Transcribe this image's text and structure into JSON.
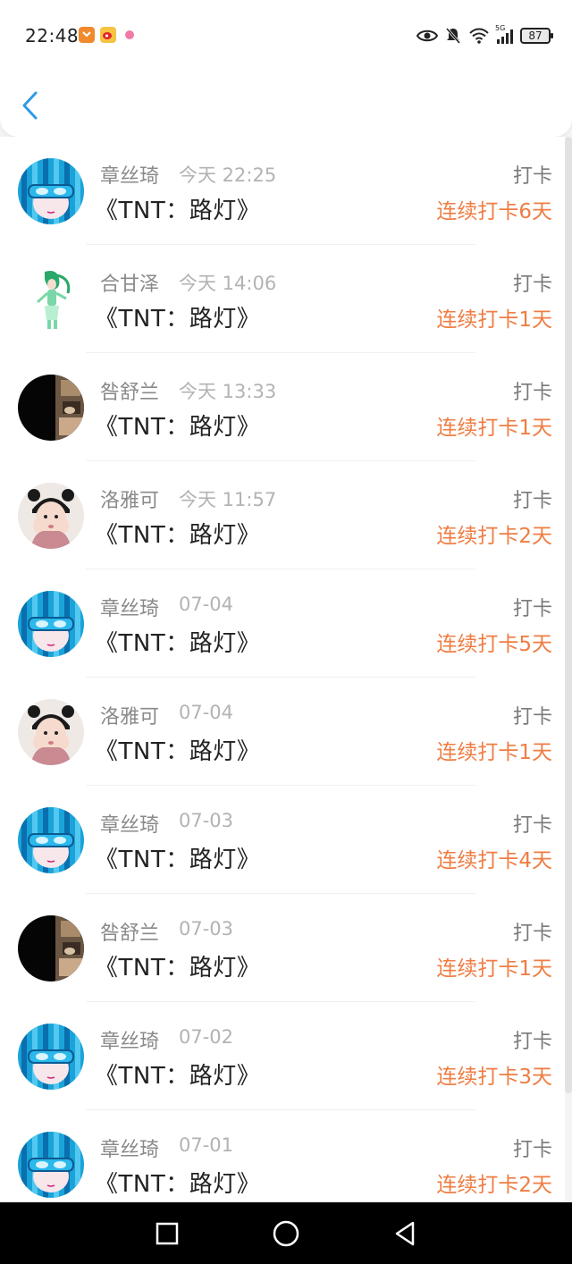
{
  "status_bar": {
    "time": "22:48",
    "battery": "87",
    "network": "5G"
  },
  "header": {
    "back_icon": "chevron-left-icon",
    "accent_color": "#2f9ae8"
  },
  "colors": {
    "streak": "#ef7d43",
    "name": "#8a8a8a",
    "time": "#b3b3b3"
  },
  "items": [
    {
      "name": "章丝琦",
      "time": "今天 22:25",
      "book": "《TNT：路灯》",
      "type": "打卡",
      "streak": "连续打卡6天",
      "avatar": "anime-blue-hair"
    },
    {
      "name": "合甘泽",
      "time": "今天 14:06",
      "book": "《TNT：路灯》",
      "type": "打卡",
      "streak": "连续打卡1天",
      "avatar": "green-figure"
    },
    {
      "name": "咎舒兰",
      "time": "今天 13:33",
      "book": "《TNT：路灯》",
      "type": "打卡",
      "streak": "连续打卡1天",
      "avatar": "dark-portrait"
    },
    {
      "name": "洛雅可",
      "time": "今天 11:57",
      "book": "《TNT：路灯》",
      "type": "打卡",
      "streak": "连续打卡2天",
      "avatar": "girl-photo"
    },
    {
      "name": "章丝琦",
      "time": "07-04",
      "book": "《TNT：路灯》",
      "type": "打卡",
      "streak": "连续打卡5天",
      "avatar": "anime-blue-hair"
    },
    {
      "name": "洛雅可",
      "time": "07-04",
      "book": "《TNT：路灯》",
      "type": "打卡",
      "streak": "连续打卡1天",
      "avatar": "girl-photo"
    },
    {
      "name": "章丝琦",
      "time": "07-03",
      "book": "《TNT：路灯》",
      "type": "打卡",
      "streak": "连续打卡4天",
      "avatar": "anime-blue-hair"
    },
    {
      "name": "咎舒兰",
      "time": "07-03",
      "book": "《TNT：路灯》",
      "type": "打卡",
      "streak": "连续打卡1天",
      "avatar": "dark-portrait"
    },
    {
      "name": "章丝琦",
      "time": "07-02",
      "book": "《TNT：路灯》",
      "type": "打卡",
      "streak": "连续打卡3天",
      "avatar": "anime-blue-hair"
    },
    {
      "name": "章丝琦",
      "time": "07-01",
      "book": "《TNT：路灯》",
      "type": "打卡",
      "streak": "连续打卡2天",
      "avatar": "anime-blue-hair"
    }
  ],
  "nav": {
    "recent_icon": "square-icon",
    "home_icon": "circle-icon",
    "back_icon": "triangle-back-icon"
  }
}
